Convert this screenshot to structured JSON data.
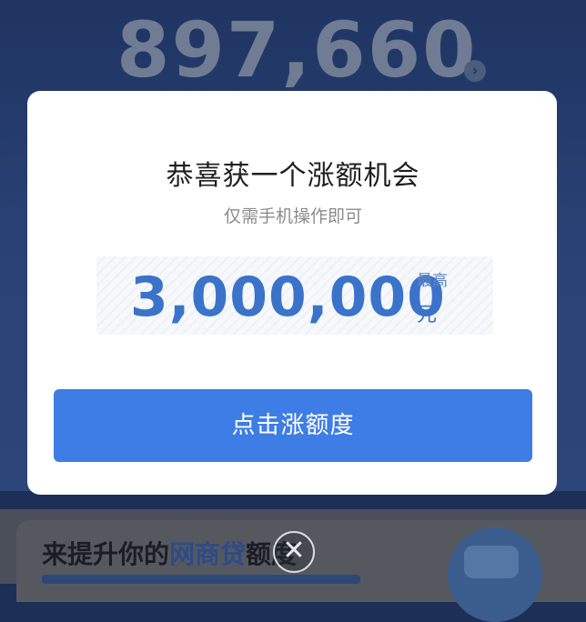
{
  "background": {
    "balance": "897,660",
    "promo_prefix": "来提升你的",
    "promo_highlight": "网商贷",
    "promo_suffix": "额度"
  },
  "modal": {
    "title": "恭喜获一个涨额机会",
    "subtitle": "仅需手机操作即可",
    "amount": "3,000,000",
    "amount_max_label": "最高",
    "amount_unit": "元",
    "cta_label": "点击涨额度"
  },
  "close": {
    "symbol": "✕"
  },
  "colors": {
    "accent": "#3e7de6",
    "amount": "#3a73c9",
    "overlay": "#1f3461"
  }
}
